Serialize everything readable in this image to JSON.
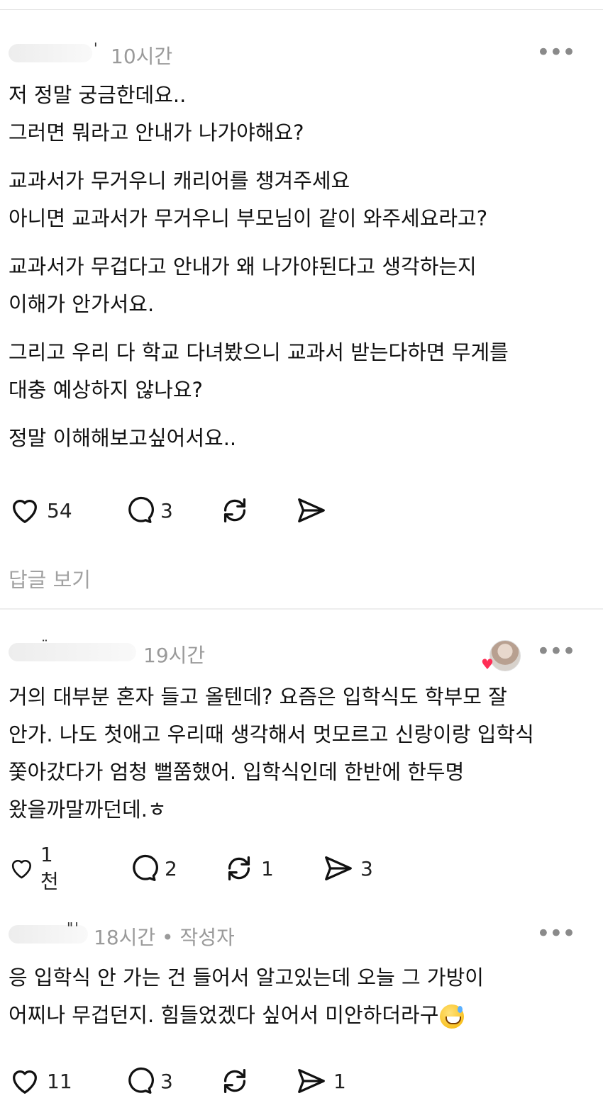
{
  "posts": [
    {
      "time": "10시간",
      "lines": [
        "저 정말 궁금한데요..",
        "그러면 뭐라고 안내가 나가야해요?",
        "",
        "교과서가 무거우니 캐리어를 챙겨주세요",
        "아니면 교과서가 무거우니 부모님이 같이 와주세요라고?",
        "",
        "교과서가 무겁다고 안내가 왜 나가야된다고 생각하는지",
        "이해가 안가서요.",
        "",
        "그리고 우리 다 학교 다녀봤으니 교과서 받는다하면 무게를",
        "대충 예상하지 않나요?",
        "",
        "정말 이해해보고싶어서요.."
      ],
      "likes": "54",
      "comments": "3",
      "reposts": "",
      "shares": "",
      "replies_link": "답글 보기"
    },
    {
      "time": "19시간",
      "lines": [
        "거의 대부분 혼자 들고 올텐데?  요즘은 입학식도 학부모 잘",
        "안가. 나도 첫애고 우리때 생각해서 멋모르고 신랑이랑 입학식",
        "쫓아갔다가 엄청 뻘쭘했어. 입학식인데 한반에 한두명",
        "왔을까말까던데.ㅎ"
      ],
      "likes": "1천",
      "comments": "2",
      "reposts": "1",
      "shares": "3"
    },
    {
      "time": "18시간 • 작성자",
      "lines": [
        "응 입학식 안 가는 건 들어서 알고있는데 오늘 그 가방이",
        "어찌나 무겁던지. 힘들었겠다 싶어서 미안하더라구"
      ],
      "likes": "11",
      "comments": "3",
      "reposts": "",
      "shares": "1"
    }
  ],
  "icons": {
    "more": "more-horizontal-icon",
    "like": "heart-icon",
    "comment": "comment-bubble-icon",
    "repost": "repost-icon",
    "share": "send-icon",
    "emoji": "grinning-sweat-emoji"
  },
  "colors": {
    "text": "#111111",
    "muted": "#9a9a9a",
    "badge_heart": "#ff2d55"
  }
}
